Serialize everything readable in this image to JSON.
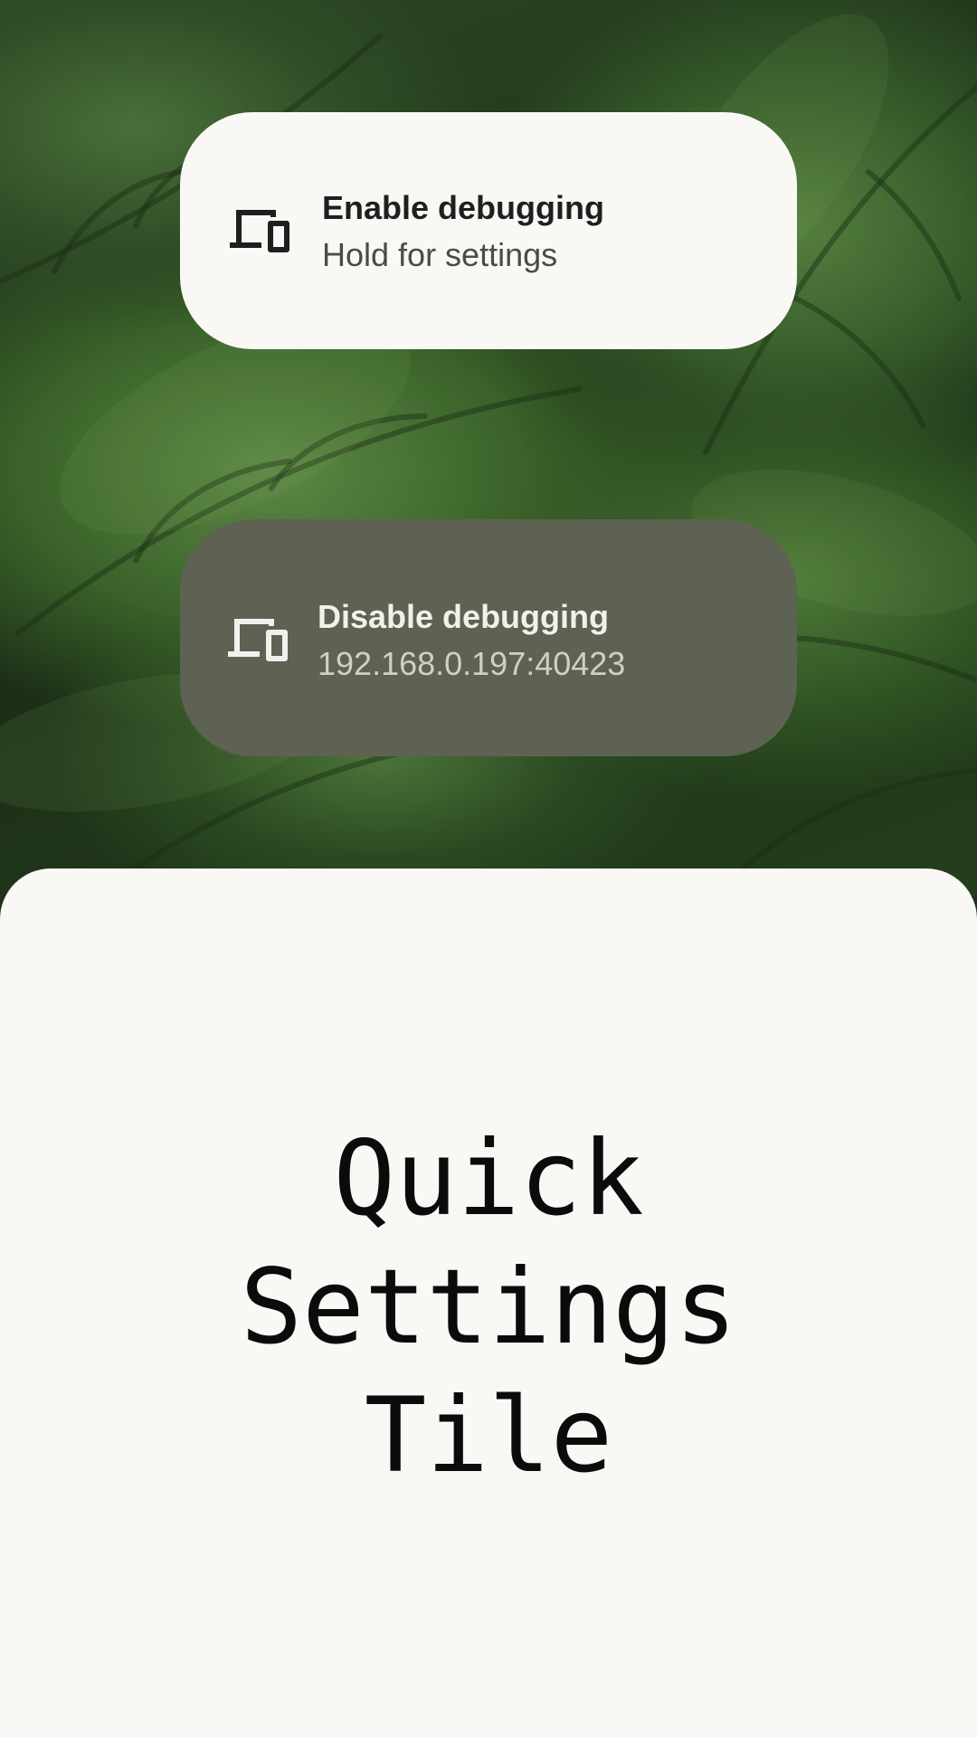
{
  "tiles": {
    "enabled": {
      "title": "Enable debugging",
      "subtitle": "Hold for settings",
      "icon": "devices-icon",
      "background": "#f9f8f5"
    },
    "disabled": {
      "title": "Disable debugging",
      "subtitle": "192.168.0.197:40423",
      "icon": "devices-icon",
      "background": "#5d6252"
    }
  },
  "sheet": {
    "title_lines": [
      "Quick",
      "Settings",
      "Tile"
    ]
  }
}
